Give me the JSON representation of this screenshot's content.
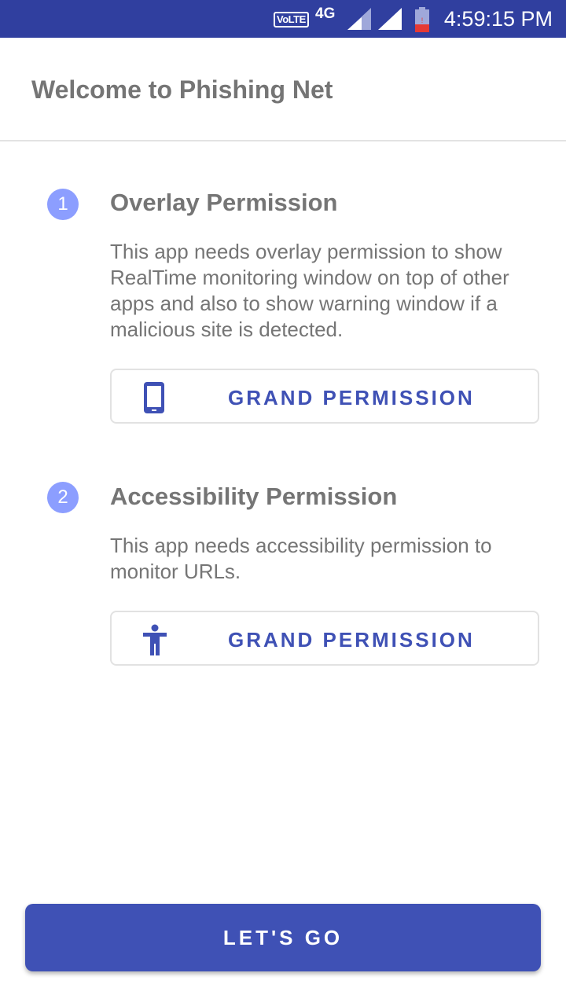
{
  "status_bar": {
    "volte_label": "VoLTE",
    "network_type": "4G",
    "time": "4:59:15 PM",
    "icons": [
      "signal-icon",
      "signal-icon",
      "battery-icon"
    ]
  },
  "app_bar": {
    "title": "Welcome to Phishing Net"
  },
  "steps": [
    {
      "number": "1",
      "title": "Overlay Permission",
      "description": "This app needs overlay permission to show RealTime monitoring window on top of other apps and also to show warning window if a malicious site is detected.",
      "button_label": "GRAND PERMISSION",
      "button_icon": "phone-icon"
    },
    {
      "number": "2",
      "title": "Accessibility Permission",
      "description": "This app needs accessibility permission to monitor URLs.",
      "button_label": "GRAND PERMISSION",
      "button_icon": "accessibility-icon"
    }
  ],
  "footer": {
    "go_label": "LET'S GO"
  },
  "colors": {
    "status_bar": "#303f9f",
    "primary": "#3f51b5",
    "step_badge": "#8c9eff",
    "text_gray": "#757575"
  }
}
